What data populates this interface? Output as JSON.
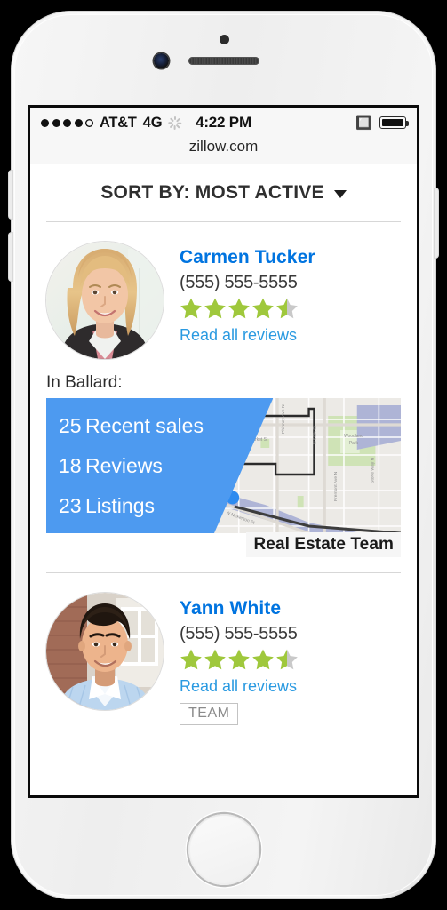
{
  "device": {
    "name": "iPhone",
    "body_color": "#f1f1f1"
  },
  "status_bar": {
    "signal_dots_filled": 4,
    "signal_dots_total": 5,
    "carrier": "AT&T",
    "network": "4G",
    "activity_icon": "spinner-icon",
    "time": "4:22 PM",
    "bluetooth_icon": "bluetooth-icon",
    "battery_icon": "battery-full-icon"
  },
  "browser": {
    "url": "zillow.com"
  },
  "sort": {
    "label": "SORT BY: MOST ACTIVE",
    "caret_icon": "chevron-down-icon"
  },
  "agents": [
    {
      "avatar_name": "agent-avatar-carmen-tucker",
      "name": "Carmen Tucker",
      "phone": "(555) 555-5555",
      "rating": 4.5,
      "rating_max": 5,
      "reviews_link": "Read all reviews",
      "team_badge": null,
      "area": {
        "label": "In Ballard:",
        "stats": [
          {
            "value": "25",
            "label": "Recent sales"
          },
          {
            "value": "18",
            "label": "Reviews"
          },
          {
            "value": "23",
            "label": "Listings"
          }
        ],
        "ribbon": "Real Estate Team"
      }
    },
    {
      "avatar_name": "agent-avatar-yann-white",
      "name": "Yann White",
      "phone": "(555) 555-5555",
      "rating": 4.5,
      "rating_max": 5,
      "reviews_link": "Read all reviews",
      "team_badge": "TEAM",
      "area": null
    }
  ],
  "colors": {
    "link_blue": "#0074E0",
    "review_link_blue": "#2a9ae1",
    "star_green": "#9FC83C",
    "star_empty": "#c9c9c9",
    "overlay_blue": "#4D9AF0",
    "map_pin_blue": "#2E8BEF"
  }
}
